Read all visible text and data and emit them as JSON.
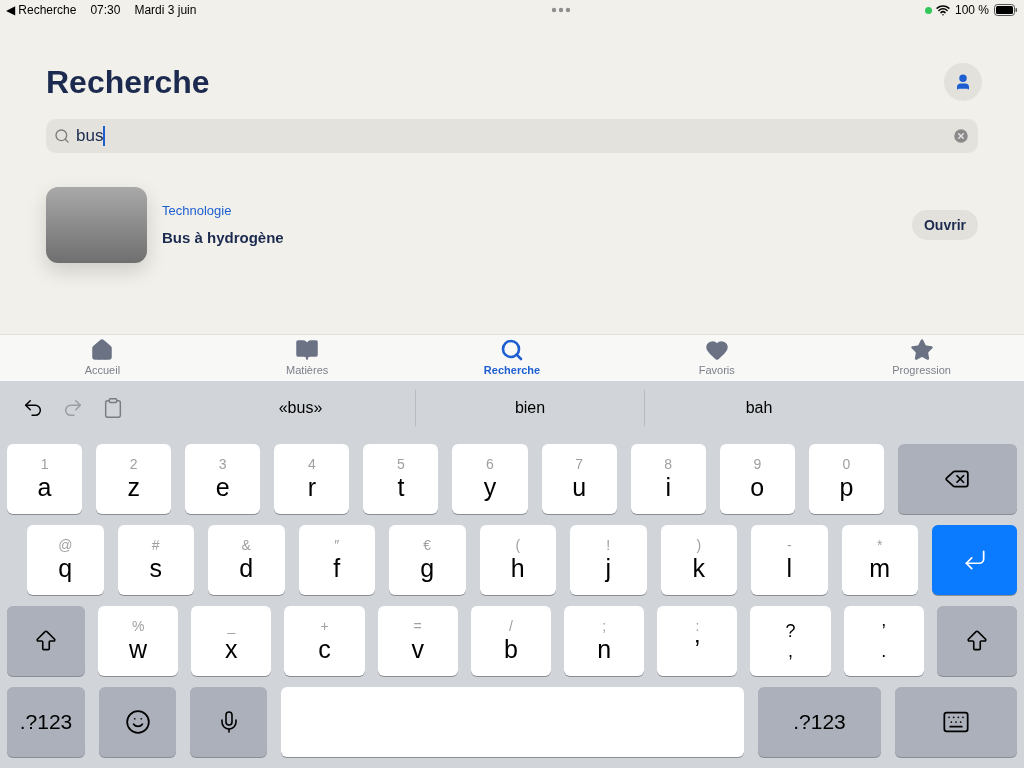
{
  "status_bar": {
    "back": "◀ Recherche",
    "time": "07:30",
    "date": "Mardi 3 juin",
    "battery": "100 %"
  },
  "page": {
    "title": "Recherche"
  },
  "search": {
    "value": "bus"
  },
  "results": [
    {
      "category": "Technologie",
      "title": "Bus à hydrogène",
      "action": "Ouvrir"
    }
  ],
  "tabs": [
    {
      "label": "Accueil",
      "selected": false
    },
    {
      "label": "Matières",
      "selected": false
    },
    {
      "label": "Recherche",
      "selected": true
    },
    {
      "label": "Favoris",
      "selected": false
    },
    {
      "label": "Progression",
      "selected": false
    }
  ],
  "suggestions": [
    "«bus»",
    "bien",
    "bah"
  ],
  "keyboard": {
    "rows": [
      [
        {
          "kind": "letter",
          "label": "a",
          "secondary": "1"
        },
        {
          "kind": "letter",
          "label": "z",
          "secondary": "2"
        },
        {
          "kind": "letter",
          "label": "e",
          "secondary": "3"
        },
        {
          "kind": "letter",
          "label": "r",
          "secondary": "4"
        },
        {
          "kind": "letter",
          "label": "t",
          "secondary": "5"
        },
        {
          "kind": "letter",
          "label": "y",
          "secondary": "6"
        },
        {
          "kind": "letter",
          "label": "u",
          "secondary": "7"
        },
        {
          "kind": "letter",
          "label": "i",
          "secondary": "8"
        },
        {
          "kind": "letter",
          "label": "o",
          "secondary": "9"
        },
        {
          "kind": "letter",
          "label": "p",
          "secondary": "0"
        },
        {
          "kind": "delete"
        }
      ],
      [
        {
          "kind": "letter",
          "label": "q",
          "secondary": "@"
        },
        {
          "kind": "letter",
          "label": "s",
          "secondary": "#"
        },
        {
          "kind": "letter",
          "label": "d",
          "secondary": "&"
        },
        {
          "kind": "letter",
          "label": "f",
          "secondary": "″"
        },
        {
          "kind": "letter",
          "label": "g",
          "secondary": "€"
        },
        {
          "kind": "letter",
          "label": "h",
          "secondary": "("
        },
        {
          "kind": "letter",
          "label": "j",
          "secondary": "!"
        },
        {
          "kind": "letter",
          "label": "k",
          "secondary": ")"
        },
        {
          "kind": "letter",
          "label": "l",
          "secondary": "-"
        },
        {
          "kind": "letter",
          "label": "m",
          "secondary": "*"
        },
        {
          "kind": "return"
        }
      ],
      [
        {
          "kind": "shift"
        },
        {
          "kind": "letter",
          "label": "w",
          "secondary": "%"
        },
        {
          "kind": "letter",
          "label": "x",
          "secondary": "_"
        },
        {
          "kind": "letter",
          "label": "c",
          "secondary": "+"
        },
        {
          "kind": "letter",
          "label": "v",
          "secondary": "="
        },
        {
          "kind": "letter",
          "label": "b",
          "secondary": "/"
        },
        {
          "kind": "letter",
          "label": "n",
          "secondary": ";"
        },
        {
          "kind": "letter",
          "label": "’",
          "secondary": ":"
        },
        {
          "kind": "dual",
          "label": ",",
          "secondary": "?"
        },
        {
          "kind": "dual",
          "label": ".",
          "secondary": "’"
        },
        {
          "kind": "shift"
        }
      ],
      [
        {
          "kind": "numbers",
          "label": ".?123"
        },
        {
          "kind": "emoji"
        },
        {
          "kind": "mic"
        },
        {
          "kind": "space"
        },
        {
          "kind": "numbers",
          "label": ".?123"
        },
        {
          "kind": "dismiss"
        }
      ]
    ]
  }
}
